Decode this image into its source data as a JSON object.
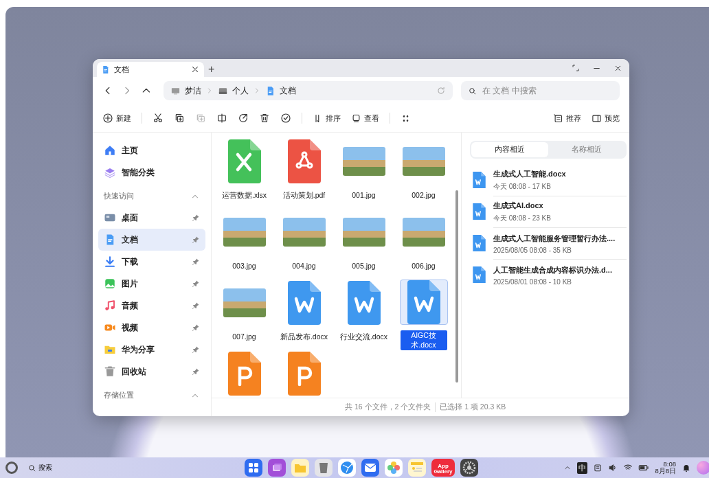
{
  "window": {
    "tabs": [
      {
        "title": "文档",
        "selected": true
      }
    ],
    "new_tab": "+"
  },
  "nav": {
    "breadcrumb": [
      {
        "label": "梦洁",
        "kind": "computer"
      },
      {
        "label": "个人",
        "kind": "drive"
      },
      {
        "label": "文档",
        "kind": "document"
      }
    ],
    "search": {
      "placeholder": "在 文档 中搜索"
    }
  },
  "toolbar": {
    "new": "新建",
    "tools": [
      {
        "kind": "cut",
        "disabled": false
      },
      {
        "kind": "copy",
        "disabled": false
      },
      {
        "kind": "paste",
        "disabled": true
      },
      {
        "kind": "compress",
        "disabled": false
      },
      {
        "kind": "share",
        "disabled": false
      },
      {
        "kind": "delete",
        "disabled": false
      },
      {
        "kind": "select",
        "disabled": false
      }
    ],
    "sort": "排序",
    "view": "查看",
    "recommend": "推荐",
    "preview": "预览"
  },
  "sidebar": {
    "top": [
      {
        "label": "主页",
        "kind": "home",
        "selected": false
      },
      {
        "label": "智能分类",
        "kind": "smart",
        "selected": false
      }
    ],
    "sections": [
      {
        "title": "快速访问",
        "expanded": true,
        "items": [
          {
            "label": "桌面",
            "kind": "desktop",
            "selected": false
          },
          {
            "label": "文档",
            "kind": "document",
            "selected": true
          },
          {
            "label": "下载",
            "kind": "download",
            "selected": false
          },
          {
            "label": "图片",
            "kind": "picture",
            "selected": false
          },
          {
            "label": "音频",
            "kind": "music",
            "selected": false
          },
          {
            "label": "视频",
            "kind": "video",
            "selected": false
          },
          {
            "label": "华为分享",
            "kind": "share",
            "selected": false
          },
          {
            "label": "回收站",
            "kind": "trash",
            "selected": false
          }
        ]
      },
      {
        "title": "存储位置",
        "expanded": true
      }
    ]
  },
  "files": [
    {
      "name": "运营数据.xlsx",
      "kind": "xlsx",
      "selected": false
    },
    {
      "name": "活动策划.pdf",
      "kind": "pdf",
      "selected": false
    },
    {
      "name": "001.jpg",
      "kind": "photo",
      "selected": false
    },
    {
      "name": "002.jpg",
      "kind": "photo",
      "selected": false
    },
    {
      "name": "003.jpg",
      "kind": "photo",
      "selected": false
    },
    {
      "name": "004.jpg",
      "kind": "photo",
      "selected": false
    },
    {
      "name": "005.jpg",
      "kind": "photo",
      "selected": false
    },
    {
      "name": "006.jpg",
      "kind": "photo",
      "selected": false
    },
    {
      "name": "007.jpg",
      "kind": "photo",
      "selected": false
    },
    {
      "name": "新品发布.docx",
      "kind": "docx",
      "selected": false
    },
    {
      "name": "行业交流.docx",
      "kind": "docx",
      "selected": false
    },
    {
      "name": "AIGC技术.docx",
      "kind": "docx",
      "selected": true
    },
    {
      "kind": "pptx",
      "selected": false
    },
    {
      "kind": "pptx",
      "selected": false
    }
  ],
  "status_bar": {
    "count": "共 16 个文件，2 个文件夹",
    "selection": "已选择 1 项 20.3 KB"
  },
  "related": {
    "tabs": [
      {
        "label": "内容相近",
        "selected": true
      },
      {
        "label": "名称相近",
        "selected": false
      }
    ],
    "items": [
      {
        "name": "生成式人工智能.docx",
        "meta": "今天 08:08 - 17 KB"
      },
      {
        "name": "生成式AI.docx",
        "meta": "今天 08:08 - 23 KB"
      },
      {
        "name": "生成式人工智能服务管理暂行办法....",
        "meta": "2025/08/05 08:08 - 35 KB"
      },
      {
        "name": "人工智能生成合成内容标识办法.d...",
        "meta": "2025/08/01 08:08 - 10 KB"
      }
    ]
  },
  "taskbar": {
    "search": "搜索",
    "apps": [
      {
        "kind": "grid"
      },
      {
        "kind": "multiwindow"
      },
      {
        "kind": "files"
      },
      {
        "kind": "trash"
      },
      {
        "kind": "browser"
      },
      {
        "kind": "mail"
      },
      {
        "kind": "photos"
      },
      {
        "kind": "notes"
      },
      {
        "kind": "appgallery",
        "label": "App Gallery"
      },
      {
        "kind": "settings"
      }
    ],
    "ime": "中",
    "time": "8:08",
    "date": "8月8日"
  }
}
